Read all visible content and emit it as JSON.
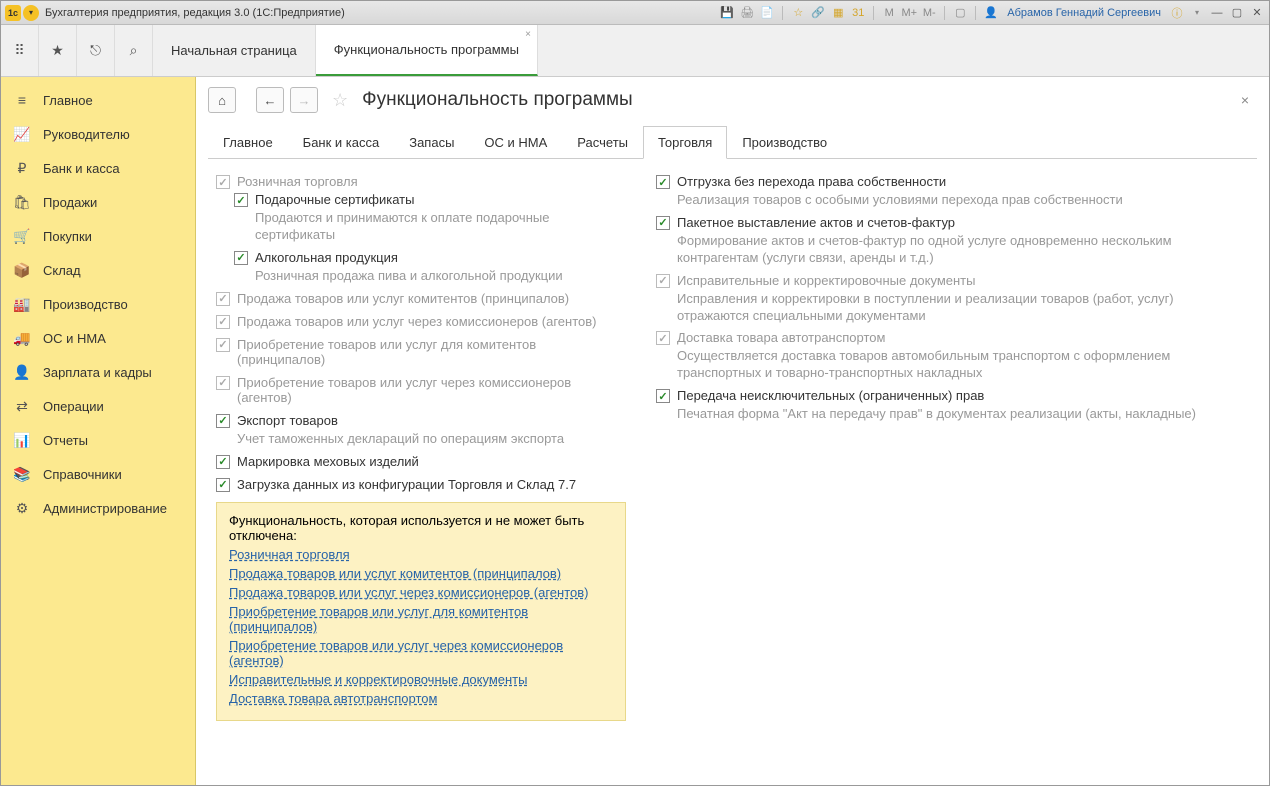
{
  "titlebar": {
    "title": "Бухгалтерия предприятия, редакция 3.0  (1С:Предприятие)",
    "user": "Абрамов Геннадий Сергеевич",
    "m_buttons": [
      "M",
      "M+",
      "M-"
    ]
  },
  "tabs": [
    {
      "label": "Начальная страница",
      "active": false
    },
    {
      "label": "Функциональность программы",
      "active": true
    }
  ],
  "sidebar": [
    {
      "icon": "≡",
      "label": "Главное"
    },
    {
      "icon": "📈",
      "label": "Руководителю"
    },
    {
      "icon": "₽",
      "label": "Банк и касса"
    },
    {
      "icon": "🛍",
      "label": "Продажи"
    },
    {
      "icon": "🛒",
      "label": "Покупки"
    },
    {
      "icon": "📦",
      "label": "Склад"
    },
    {
      "icon": "🏭",
      "label": "Производство"
    },
    {
      "icon": "🚚",
      "label": "ОС и НМА"
    },
    {
      "icon": "👤",
      "label": "Зарплата и кадры"
    },
    {
      "icon": "⇄",
      "label": "Операции"
    },
    {
      "icon": "📊",
      "label": "Отчеты"
    },
    {
      "icon": "📚",
      "label": "Справочники"
    },
    {
      "icon": "⚙",
      "label": "Администрирование"
    }
  ],
  "page": {
    "title": "Функциональность программы"
  },
  "subtabs": [
    "Главное",
    "Банк и касса",
    "Запасы",
    "ОС и НМА",
    "Расчеты",
    "Торговля",
    "Производство"
  ],
  "active_subtab": 5,
  "left_col": {
    "opt_retail": {
      "label": "Розничная торговля",
      "checked": true,
      "disabled": true
    },
    "opt_gift": {
      "label": "Подарочные сертификаты",
      "checked": true,
      "desc": "Продаются и принимаются к оплате подарочные сертификаты"
    },
    "opt_alco": {
      "label": "Алкогольная продукция",
      "checked": true,
      "desc": "Розничная продажа пива и алкогольной продукции"
    },
    "opt_komitent_sale": {
      "label": "Продажа товаров или услуг комитентов (принципалов)",
      "checked": true,
      "disabled": true
    },
    "opt_agent_sale": {
      "label": "Продажа товаров или услуг через комиссионеров (агентов)",
      "checked": true,
      "disabled": true
    },
    "opt_komitent_buy": {
      "label": "Приобретение товаров или услуг для комитентов (принципалов)",
      "checked": true,
      "disabled": true
    },
    "opt_agent_buy": {
      "label": "Приобретение товаров или услуг через комиссионеров (агентов)",
      "checked": true,
      "disabled": true
    },
    "opt_export": {
      "label": "Экспорт товаров",
      "checked": true,
      "desc": "Учет таможенных деклараций по операциям экспорта"
    },
    "opt_fur": {
      "label": "Маркировка меховых изделий",
      "checked": true
    },
    "opt_load77": {
      "label": "Загрузка данных из конфигурации Торговля и Склад 7.7",
      "checked": true
    }
  },
  "right_col": {
    "opt_ship": {
      "label": "Отгрузка без перехода права собственности",
      "checked": true,
      "desc": "Реализация товаров с особыми условиями перехода прав собственности"
    },
    "opt_batch": {
      "label": "Пакетное выставление актов и счетов-фактур",
      "checked": true,
      "desc": "Формирование актов и счетов-фактур по одной услуге одновременно нескольким контрагентам (услуги связи, аренды и т.д.)"
    },
    "opt_correct": {
      "label": "Исправительные и корректировочные документы",
      "checked": true,
      "disabled": true,
      "desc": "Исправления и корректировки в поступлении и реализации товаров (работ, услуг) отражаются специальными документами"
    },
    "opt_delivery": {
      "label": "Доставка товара автотранспортом",
      "checked": true,
      "disabled": true,
      "desc": "Осуществляется доставка товаров автомобильным транспортом с оформлением транспортных и товарно-транспортных накладных"
    },
    "opt_rights": {
      "label": "Передача неисключительных (ограниченных) прав",
      "checked": true,
      "desc": "Печатная форма \"Акт на передачу прав\" в документах реализации (акты, накладные)"
    }
  },
  "infobox": {
    "title": "Функциональность, которая используется и не может быть отключена:",
    "links": [
      "Розничная торговля",
      "Продажа товаров или услуг комитентов (принципалов)",
      "Продажа товаров или услуг через комиссионеров (агентов)",
      "Приобретение товаров или услуг для комитентов (принципалов)",
      "Приобретение товаров или услуг через комиссионеров (агентов)",
      "Исправительные и корректировочные документы",
      "Доставка товара автотранспортом"
    ]
  }
}
